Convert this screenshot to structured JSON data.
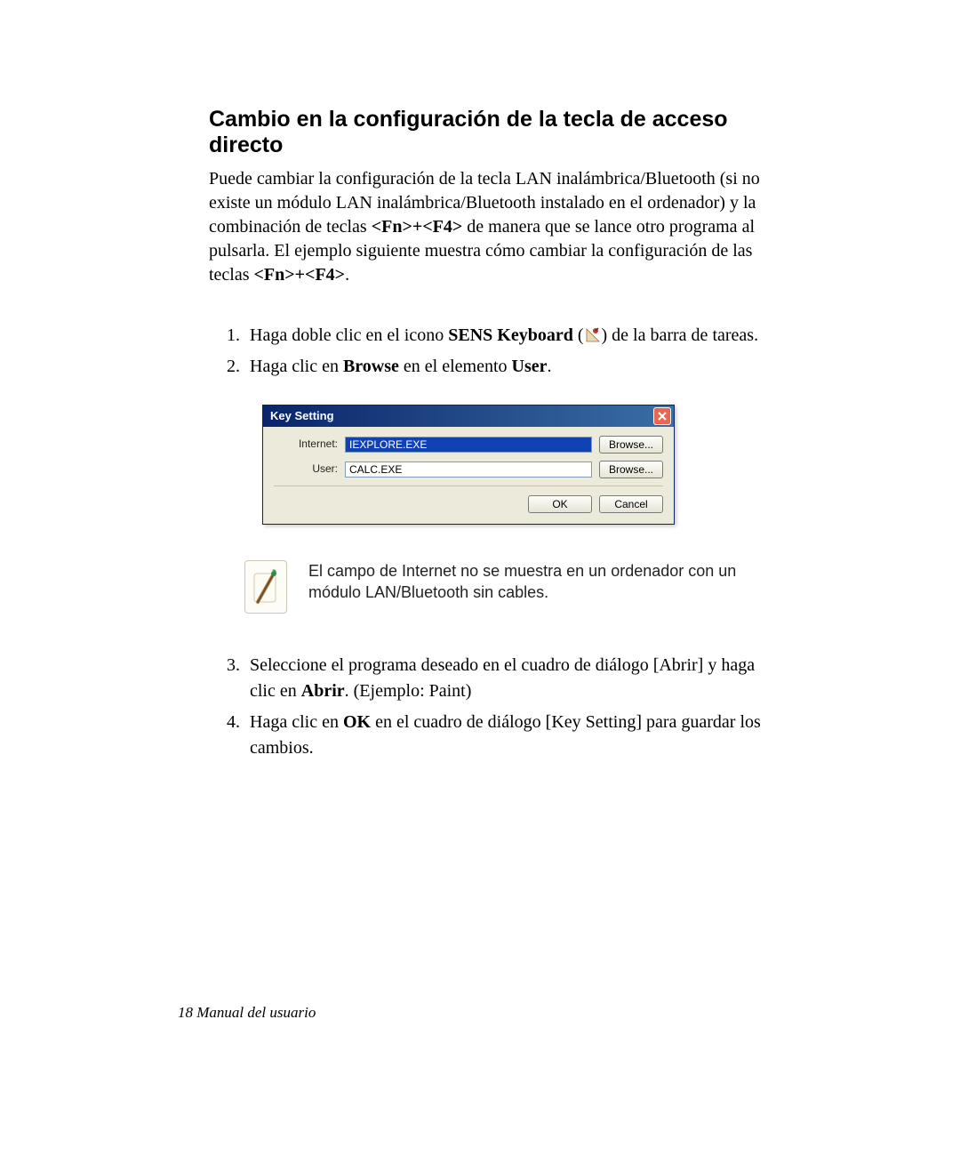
{
  "heading": "Cambio en la configuración de la tecla de acceso directo",
  "intro": {
    "pre": "Puede cambiar la configuración de la tecla LAN inalámbrica/Bluetooth (si no existe un módulo LAN inalámbrica/Bluetooth instalado en el ordenador) y la combinación de teclas ",
    "hot1": "<Fn>+<F4>",
    "mid": " de manera que se lance otro programa al pulsarla. El ejemplo siguiente muestra cómo cambiar la configuración de las teclas ",
    "hot2": "<Fn>+<F4>",
    "end": "."
  },
  "steps": {
    "s1": {
      "a": "Haga doble clic en el icono ",
      "b": "SENS Keyboard",
      "c": " (",
      "d": ") de la barra de tareas."
    },
    "s2": {
      "a": "Haga clic en ",
      "b": "Browse",
      "c": " en el elemento ",
      "d": "User",
      "e": "."
    },
    "s3": {
      "a": "Seleccione el programa deseado en el cuadro de diálogo [Abrir] y haga clic en ",
      "b": "Abrir",
      "c": ". (Ejemplo: Paint)"
    },
    "s4": {
      "a": "Haga clic en ",
      "b": "OK",
      "c": " en el cuadro de diálogo [Key Setting] para guardar los cambios."
    }
  },
  "dialog": {
    "title": "Key Setting",
    "internet_label": "Internet:",
    "internet_value": "IEXPLORE.EXE",
    "user_label": "User:",
    "user_value": "CALC.EXE",
    "browse": "Browse...",
    "ok": "OK",
    "cancel": "Cancel"
  },
  "note": "El campo de Internet no se muestra en un ordenador con un módulo LAN/Bluetooth sin cables.",
  "footer": {
    "page": "18",
    "sep": "  ",
    "label": "Manual del usuario"
  }
}
